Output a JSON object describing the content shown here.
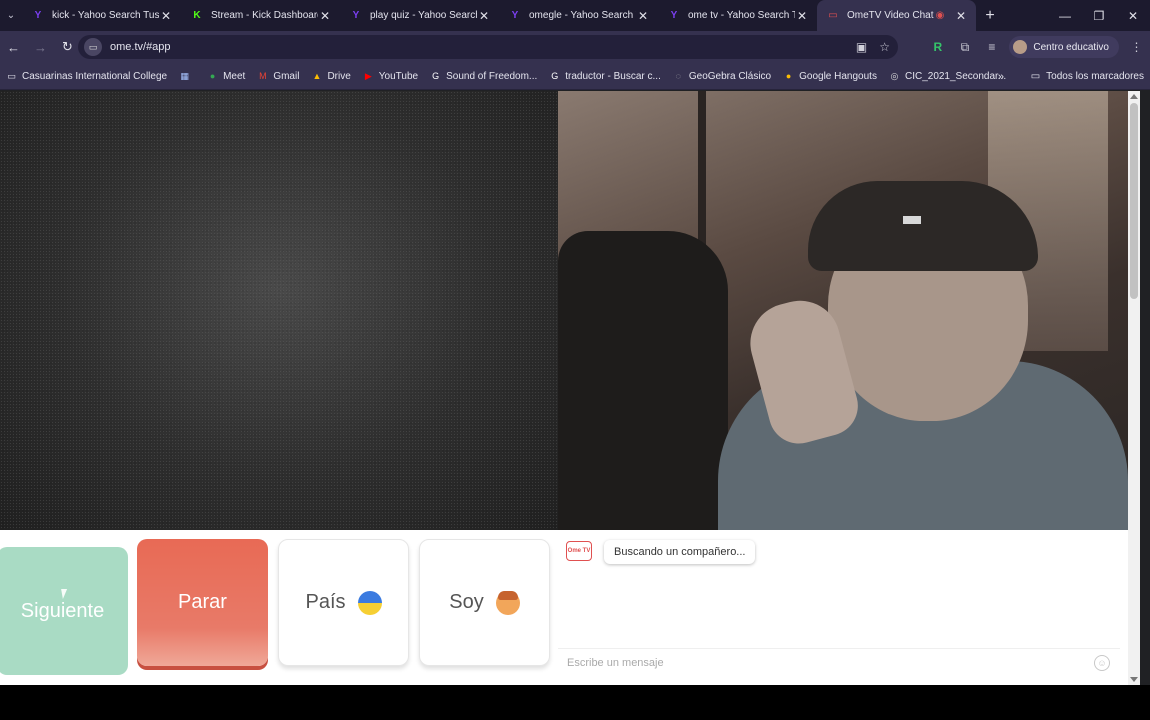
{
  "browser": {
    "tabs": [
      {
        "title": "kick - Yahoo Search Tus re",
        "favicon": "Y",
        "color": "#7b3ff2"
      },
      {
        "title": "Stream - Kick Dashboard",
        "favicon": "K",
        "color": "#53fc18"
      },
      {
        "title": "play quiz - Yahoo Search T",
        "favicon": "Y",
        "color": "#7b3ff2"
      },
      {
        "title": "omegle - Yahoo Search Tu",
        "favicon": "Y",
        "color": "#7b3ff2"
      },
      {
        "title": "ome tv - Yahoo Search Tus",
        "favicon": "Y",
        "color": "#7b3ff2"
      },
      {
        "title": "OmeTV Video Chat -",
        "favicon": "▭",
        "color": "#e05050"
      }
    ],
    "new_tab": "+",
    "window_controls": [
      "—",
      "❐",
      "✕"
    ],
    "url": "ome.tv/#app",
    "profile_label": "Centro educativo",
    "bookmarks": [
      {
        "label": "Casuarinas International College",
        "icon": "▭"
      },
      {
        "label": "",
        "icon": "▦"
      },
      {
        "label": "Meet",
        "icon": "●"
      },
      {
        "label": "Gmail",
        "icon": "M"
      },
      {
        "label": "Drive",
        "icon": "▲"
      },
      {
        "label": "YouTube",
        "icon": "▶"
      },
      {
        "label": "Sound of Freedom...",
        "icon": "G"
      },
      {
        "label": "traductor - Buscar c...",
        "icon": "G"
      },
      {
        "label": "GeoGebra Clásico",
        "icon": "◌"
      },
      {
        "label": "Google Hangouts",
        "icon": "●"
      },
      {
        "label": "CIC_2021_Secondar...",
        "icon": "◎"
      }
    ],
    "bookmarks_more": "»",
    "all_bookmarks": "Todos los marcadores"
  },
  "app": {
    "buttons": {
      "next": "Siguiente",
      "stop": "Parar",
      "country": "País",
      "gender": "Soy"
    },
    "chat": {
      "logo_text": "Ome TV",
      "status_message": "Buscando un compañero...",
      "input_placeholder": "Escribe un mensaje"
    }
  },
  "colors": {
    "next_button": "#a9dbc4",
    "stop_button": "#e86a55",
    "tab_bg": "#1c1a2e",
    "toolbar_bg": "#35314f"
  }
}
